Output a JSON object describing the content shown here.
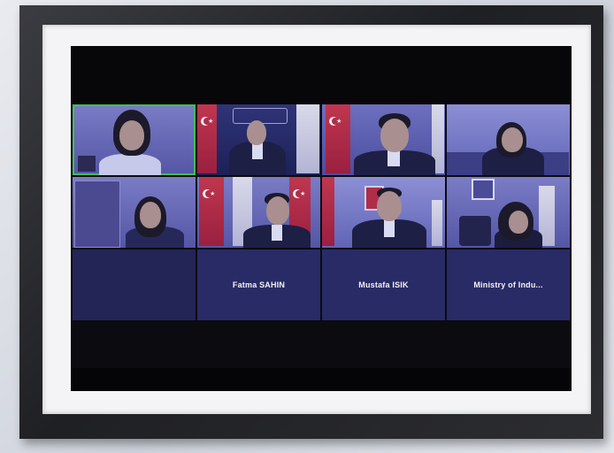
{
  "participants": [
    {
      "name": ""
    },
    {
      "name": ""
    },
    {
      "name": ""
    },
    {
      "name": ""
    },
    {
      "name": ""
    },
    {
      "name": ""
    },
    {
      "name": ""
    },
    {
      "name": ""
    },
    {
      "name": ""
    },
    {
      "name": "Fatma SAHIN"
    },
    {
      "name": "Mustafa ISIK"
    },
    {
      "name": "Ministry of Indu..."
    }
  ],
  "colors": {
    "tile_background": "#292b66",
    "active_speaker_border": "#3fbf58",
    "screen_background": "#070709"
  }
}
